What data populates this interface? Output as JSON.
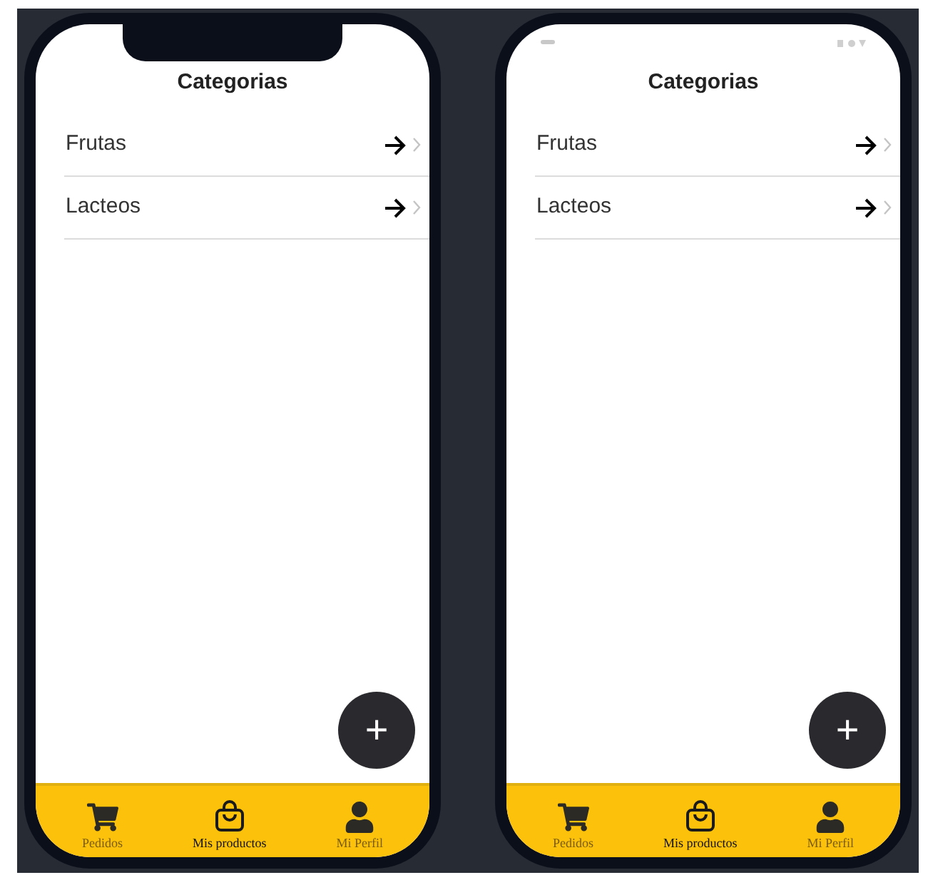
{
  "phones": [
    {
      "kind": "notch",
      "title": "Categorias",
      "categories": [
        {
          "name": "Frutas"
        },
        {
          "name": "Lacteos"
        }
      ],
      "fab": "+",
      "tabs": [
        {
          "label": "Pedidos",
          "kind": "cart",
          "selected": false
        },
        {
          "label": "Mis productos",
          "kind": "bag",
          "selected": true
        },
        {
          "label": "Mi Perfil",
          "kind": "person",
          "selected": false
        }
      ]
    },
    {
      "kind": "status_bar",
      "title": "Categorias",
      "categories": [
        {
          "name": "Frutas"
        },
        {
          "name": "Lacteos"
        }
      ],
      "fab": "+",
      "tabs": [
        {
          "label": "Pedidos",
          "kind": "cart",
          "selected": false
        },
        {
          "label": "Mis productos",
          "kind": "bag",
          "selected": true
        },
        {
          "label": "Mi Perfil",
          "kind": "person",
          "selected": false
        }
      ]
    }
  ]
}
